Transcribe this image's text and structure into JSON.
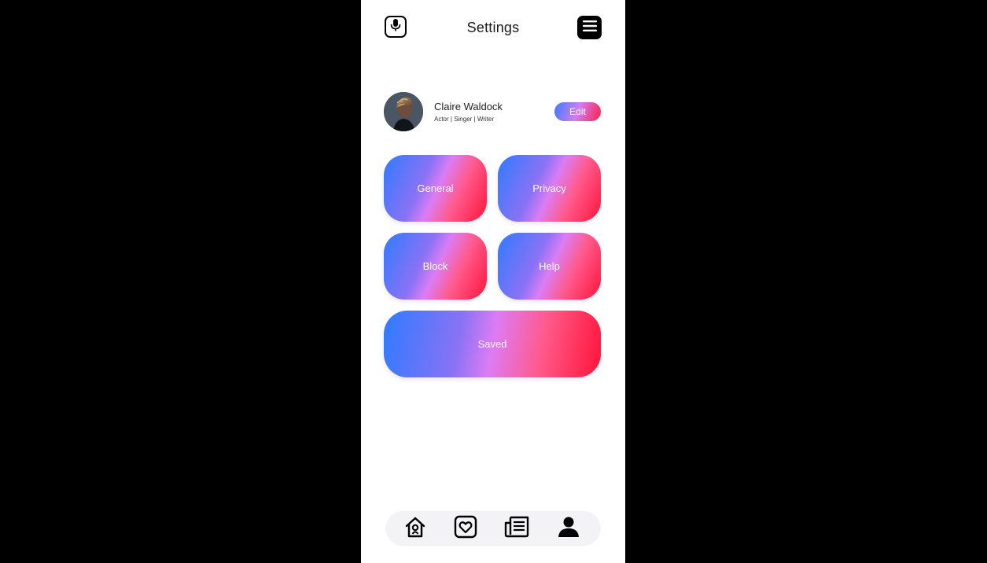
{
  "header": {
    "title": "Settings",
    "left_icon": "microphone-icon",
    "right_icon": "hamburger-menu-icon"
  },
  "profile": {
    "name": "Claire Waldock",
    "bio": "Actor | Singer | Writer",
    "edit_label": "Edit"
  },
  "tiles": {
    "general": "General",
    "privacy": "Privacy",
    "block": "Block",
    "help": "Help",
    "saved": "Saved"
  },
  "bottom_nav": {
    "items": [
      "home-icon",
      "heart-icon",
      "feed-icon",
      "user-icon"
    ]
  },
  "colors": {
    "gradient_start": "#2f7bff",
    "gradient_mid": "#dc7cf4",
    "gradient_end": "#ff1438",
    "background": "#ffffff",
    "frame": "#000000"
  }
}
